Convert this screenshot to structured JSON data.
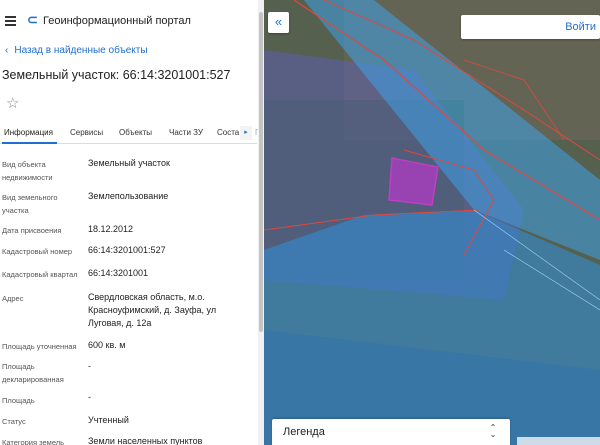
{
  "header": {
    "app_title": "Геоинформационный портал",
    "menu_icon": "hamburger-menu-icon",
    "logo_icon": "portal-logo-icon"
  },
  "nav": {
    "back_label": "Назад в найденные объекты"
  },
  "object": {
    "title": "Земельный участок: 66:14:3201001:527"
  },
  "tabs": [
    {
      "label": "Информация"
    },
    {
      "label": "Сервисы"
    },
    {
      "label": "Объекты"
    },
    {
      "label": "Части ЗУ"
    },
    {
      "label": "Соста"
    }
  ],
  "fields": [
    {
      "label": "Вид объекта недвижимости",
      "value": "Земельный участок"
    },
    {
      "label": "Вид земельного участка",
      "value": "Землепользование"
    },
    {
      "label": "Дата присвоения",
      "value": "18.12.2012"
    },
    {
      "label": "Кадастровый номер",
      "value": "66:14:3201001:527"
    },
    {
      "label": "Кадастровый квартал",
      "value": "66:14:3201001"
    },
    {
      "label": "Адрес",
      "value": "Свердловская область, м.о. Красноуфимский, д. Зауфа, ул Луговая, д. 12а"
    },
    {
      "label": "Площадь уточненная",
      "value": "600 кв. м"
    },
    {
      "label": "Площадь декларированная",
      "value": "-"
    },
    {
      "label": "Площадь",
      "value": "-"
    },
    {
      "label": "Статус",
      "value": "Учтенный"
    },
    {
      "label": "Категория земель",
      "value": "Земли населенных пунктов"
    }
  ],
  "map": {
    "collapse_label": "«",
    "login_label": "Войти",
    "legend_label": "Легенда",
    "scale_label": ""
  },
  "colors": {
    "accent": "#1f6fd1",
    "parcel_highlight": "#c036d0",
    "water_overlay": "#2f9be8",
    "cadastral_boundary": "#e0473f"
  }
}
